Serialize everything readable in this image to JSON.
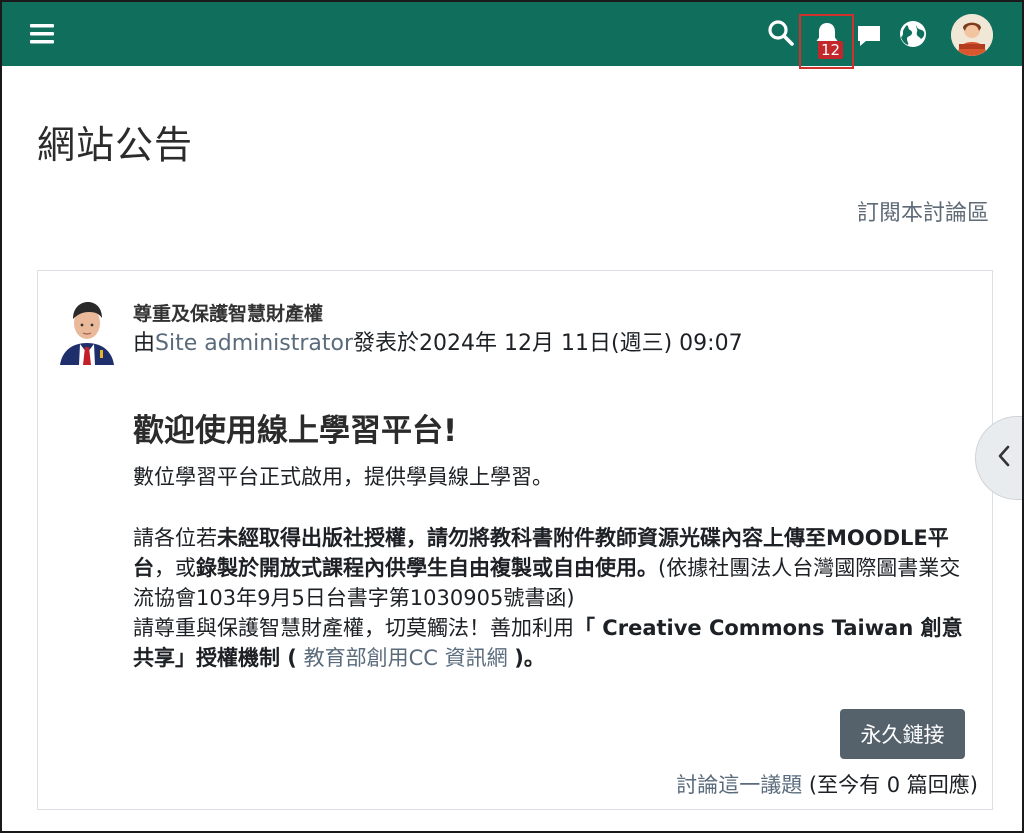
{
  "navbar": {
    "notification_count": "12",
    "brand_color": "#0f6e5c",
    "icons": [
      "menu-icon",
      "search-icon",
      "bell-icon",
      "chat-icon",
      "globe-icon",
      "user-avatar"
    ]
  },
  "page": {
    "title": "網站公告",
    "subscribe_link": "訂閱本討論區"
  },
  "post": {
    "subject": "尊重及保護智慧財產權",
    "byline_prefix": "由",
    "author": "Site administrator",
    "byline_suffix": "發表於2024年 12月 11日(週三) 09:07",
    "heading": "歡迎使用線上學習平台!",
    "paragraph1": "數位學習平台正式啟用，提供學員線上學習。",
    "p2_text1": "請各位若",
    "p2_bold1": "未經取得出版社授權，請勿將教科書附件教師資源光碟內容上傳至MOODLE平台",
    "p2_text2": "，或",
    "p2_bold2": "錄製於開放式課程內供學生自由複製或自由使用。",
    "p2_text3": "(依據社團法人台灣國際圖書業交流協會103年9月5日台書字第1030905號書函)",
    "p2_text4": "請尊重與保護智慧財產權，切莫觸法！善加利用",
    "p2_bold3": "「 Creative Commons Taiwan 創意共享」授權機制 (",
    "p2_link": " 教育部創用CC 資訊網 ",
    "p2_bold4": ")。",
    "permalink_label": "永久鏈接",
    "discuss_link": "討論這一議題",
    "reply_count_text": "(至今有 0 篇回應)"
  }
}
